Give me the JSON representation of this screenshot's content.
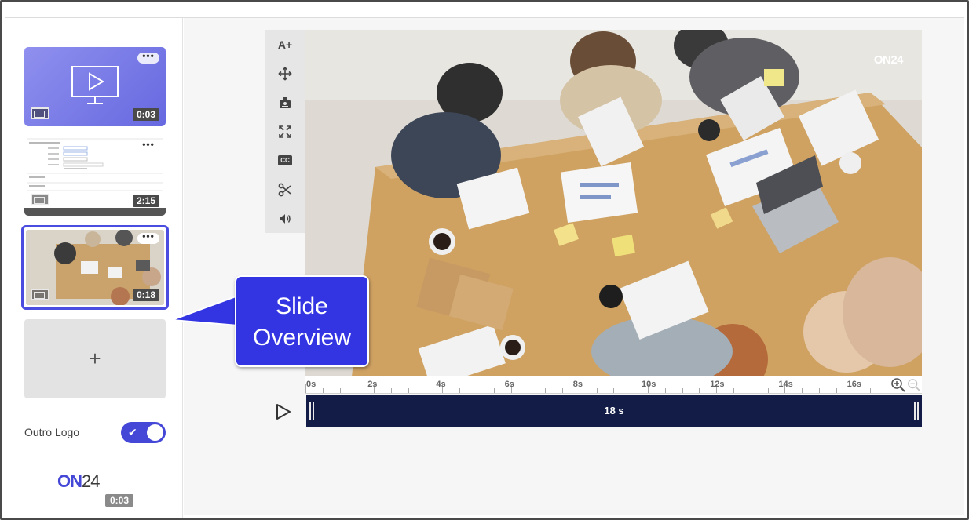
{
  "slides": [
    {
      "duration": "0:03",
      "menu": "•••"
    },
    {
      "duration": "2:15",
      "menu": "•••"
    },
    {
      "duration": "0:18",
      "menu": "•••"
    }
  ],
  "add_slide": {
    "label": "+"
  },
  "outro": {
    "label": "Outro Logo",
    "enabled": true,
    "duration": "0:03"
  },
  "logo": {
    "on": "ON",
    "num": "24"
  },
  "video": {
    "watermark": "ON24"
  },
  "toolbar": {
    "tools": [
      "text-size-icon",
      "move-icon",
      "presenter-icon",
      "fullscreen-icon",
      "cc-icon",
      "scissors-icon",
      "volume-icon"
    ],
    "text_size_label": "A+",
    "cc_label": "CC"
  },
  "timeline": {
    "ticks": [
      "0s",
      "2s",
      "4s",
      "6s",
      "8s",
      "10s",
      "12s",
      "14s",
      "16s"
    ],
    "clip_label": "18 s"
  },
  "callout": {
    "line1": "Slide",
    "line2": "Overview"
  },
  "colors": {
    "accent": "#4547d6",
    "track": "#121c46",
    "callout": "#3335e2"
  }
}
